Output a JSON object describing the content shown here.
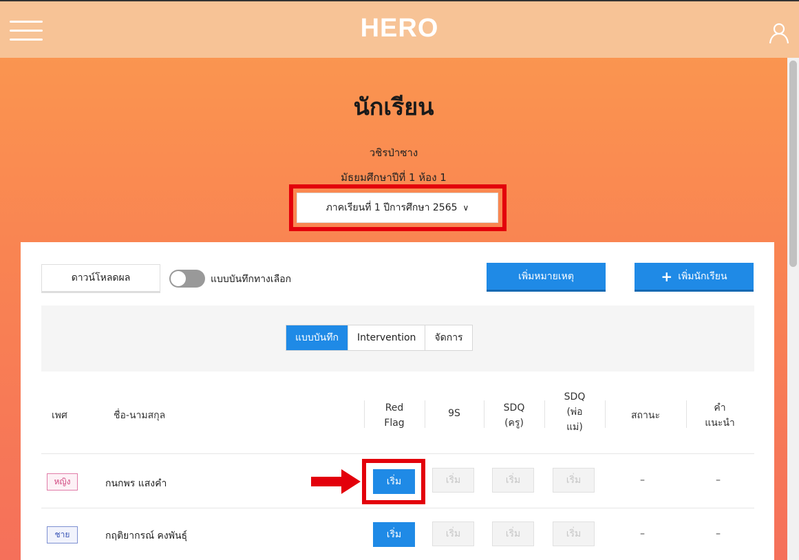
{
  "app": {
    "logo": "HERO"
  },
  "header": {
    "title": "นักเรียน",
    "school": "วชิรป่าซาง",
    "classroom": "มัธยมศึกษาปีที่ 1 ห้อง 1",
    "term_select": "ภาคเรียนที่ 1 ปีการศึกษา 2565"
  },
  "toolbar": {
    "download_label": "ดาวน์โหลดผล",
    "toggle_label": "แบบบันทึกทางเลือก",
    "toggle_on": false,
    "add_note_label": "เพิ่มหมายเหตุ",
    "add_student_label": "เพิ่มนักเรียน"
  },
  "tabs": [
    {
      "label": "แบบบันทึก",
      "active": true
    },
    {
      "label": "Intervention",
      "active": false
    },
    {
      "label": "จัดการ",
      "active": false
    }
  ],
  "table": {
    "columns": {
      "gender": "เพศ",
      "name": "ชื่อ-นามสกุล",
      "red_flag_1": "Red",
      "red_flag_2": "Flag",
      "nine_s": "9S",
      "sdq_teacher_1": "SDQ",
      "sdq_teacher_2": "(ครู)",
      "sdq_parent_1": "SDQ",
      "sdq_parent_2": "(พ่อ",
      "sdq_parent_3": "แม่)",
      "status": "สถานะ",
      "advice_1": "คำ",
      "advice_2": "แนะนำ"
    },
    "rows": [
      {
        "gender": "หญิง",
        "name": "กนกพร แสงคำ",
        "red_flag": "เริ่ม",
        "nine_s": "เริ่ม",
        "sdq_teacher": "เริ่ม",
        "sdq_parent": "เริ่ม",
        "status": "–",
        "advice": "–"
      },
      {
        "gender": "ชาย",
        "name": "กฤติยากรณ์ คงพันธุ์",
        "red_flag": "เริ่ม",
        "nine_s": "เริ่ม",
        "sdq_teacher": "เริ่ม",
        "sdq_parent": "เริ่ม",
        "status": "–",
        "advice": "–"
      }
    ]
  },
  "colors": {
    "primary": "#1f8ae6",
    "highlight": "#e3000b",
    "header_bg": "#f7c396"
  },
  "icons": {
    "menu": "hamburger-icon",
    "user": "user-icon",
    "arrow": "arrow-right-icon",
    "chevron": "chevron-down-icon",
    "plus": "plus-icon"
  }
}
